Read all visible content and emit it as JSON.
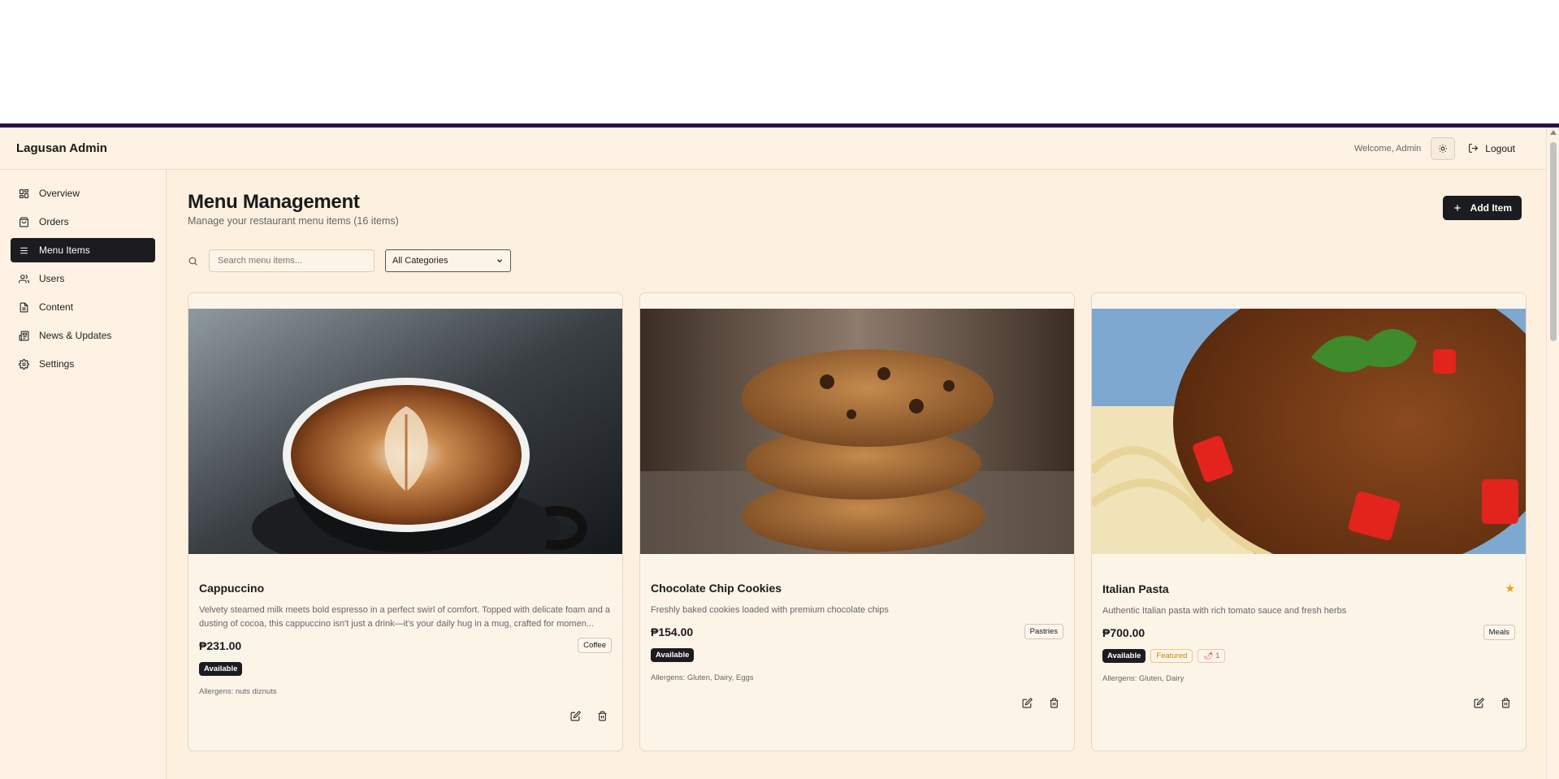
{
  "app": {
    "brand": "Lagusan Admin",
    "welcome": "Welcome, Admin",
    "logout_label": "Logout"
  },
  "sidebar": {
    "items": [
      {
        "label": "Overview",
        "icon": "grid-icon",
        "active": false
      },
      {
        "label": "Orders",
        "icon": "bag-icon",
        "active": false
      },
      {
        "label": "Menu Items",
        "icon": "list-icon",
        "active": true
      },
      {
        "label": "Users",
        "icon": "users-icon",
        "active": false
      },
      {
        "label": "Content",
        "icon": "document-icon",
        "active": false
      },
      {
        "label": "News & Updates",
        "icon": "newspaper-icon",
        "active": false
      },
      {
        "label": "Settings",
        "icon": "gear-icon",
        "active": false
      }
    ]
  },
  "main": {
    "title": "Menu Management",
    "subtitle": "Manage your restaurant menu items (16 items)",
    "add_label": "Add Item",
    "search_placeholder": "Search menu items...",
    "category_selected": "All Categories"
  },
  "cards": [
    {
      "title": "Cappuccino",
      "description": "Velvety steamed milk meets bold espresso in a perfect swirl of comfort. Topped with delicate foam and a dusting of cocoa, this cappuccino isn't just a drink—it's your daily hug in a mug, crafted for momen...",
      "price": "₱231.00",
      "category": "Coffee",
      "available": "Available",
      "allergens": "Allergens: nuts diznuts",
      "featured": false
    },
    {
      "title": "Chocolate Chip Cookies",
      "description": "Freshly baked cookies loaded with premium chocolate chips",
      "price": "₱154.00",
      "category": "Pastries",
      "available": "Available",
      "allergens": "Allergens: Gluten, Dairy, Eggs",
      "featured": false
    },
    {
      "title": "Italian Pasta",
      "description": "Authentic Italian pasta with rich tomato sauce and fresh herbs",
      "price": "₱700.00",
      "category": "Meals",
      "available": "Available",
      "featured_label": "Featured",
      "spice_level": "1",
      "allergens": "Allergens: Gluten, Dairy",
      "featured": true
    }
  ],
  "colors": {
    "accent_dark": "#1c1b1f",
    "background": "#fdf0df",
    "top_border": "#2a1248",
    "featured": "#e8a50d"
  }
}
